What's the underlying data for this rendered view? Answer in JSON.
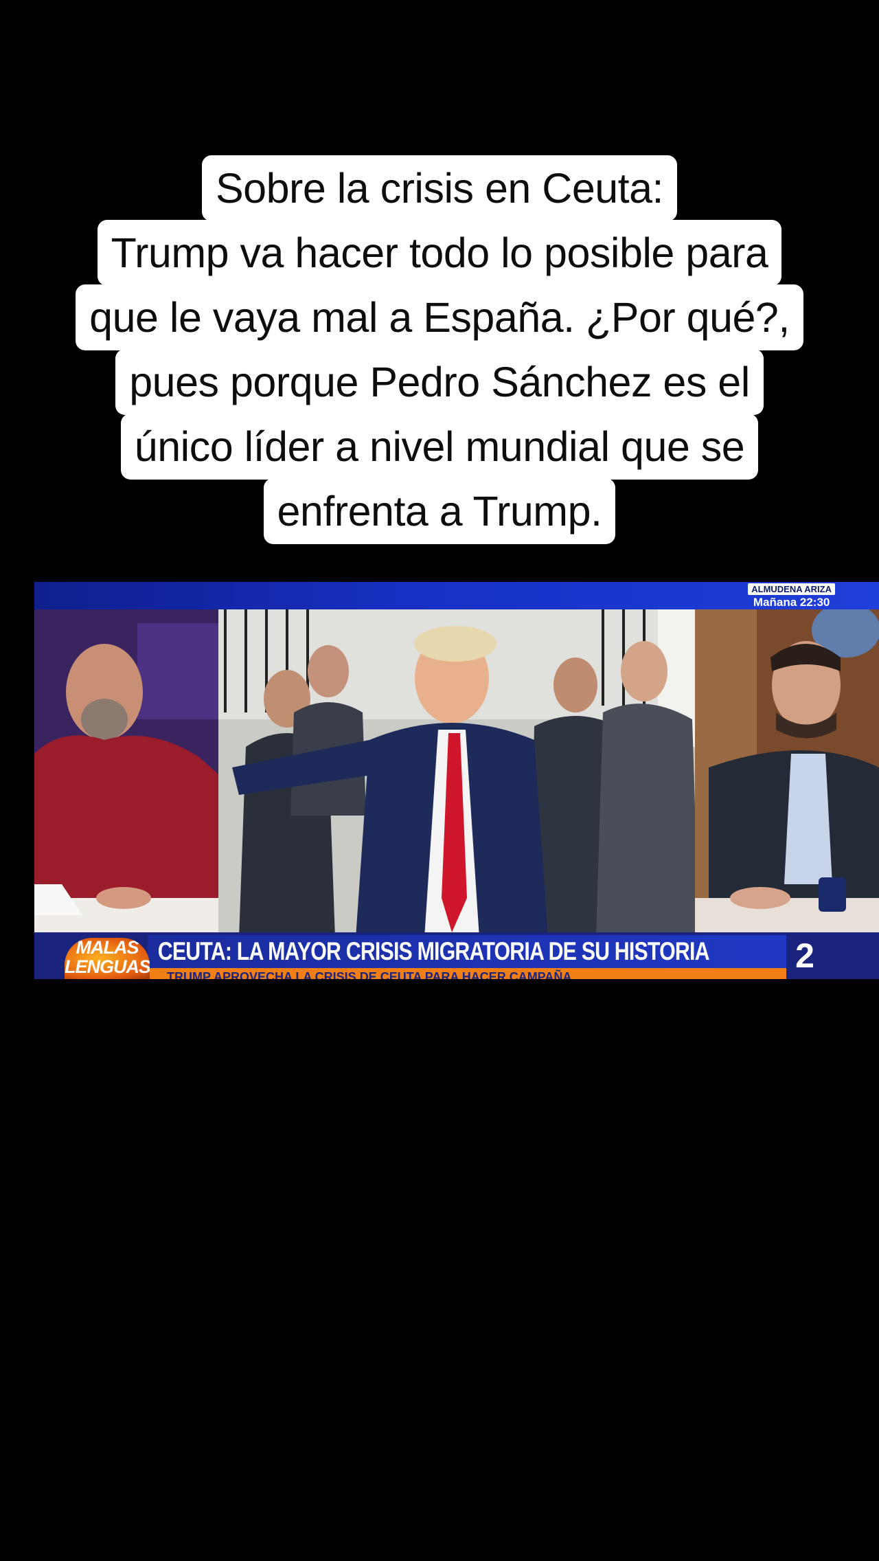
{
  "caption": {
    "lines": [
      "Sobre la crisis en Ceuta:",
      "Trump va hacer todo lo posible para",
      "que le vaya mal a España. ¿Por qué?,",
      "pues porque Pedro Sánchez es el",
      "único líder a nivel mundial que se",
      "enfrenta a Trump."
    ]
  },
  "video": {
    "promo": {
      "name": "ALMUDENA ARIZA",
      "time": "Mañana 22:30"
    },
    "show_logo": {
      "line1": "MALAS",
      "line2": "LENGUAS"
    },
    "headline": "CEUTA: LA MAYOR CRISIS MIGRATORIA DE SU HISTORIA",
    "subheadline": "TRUMP APROVECHA LA CRISIS DE CEUTA PARA HACER CAMPAÑA",
    "channel": "2"
  }
}
